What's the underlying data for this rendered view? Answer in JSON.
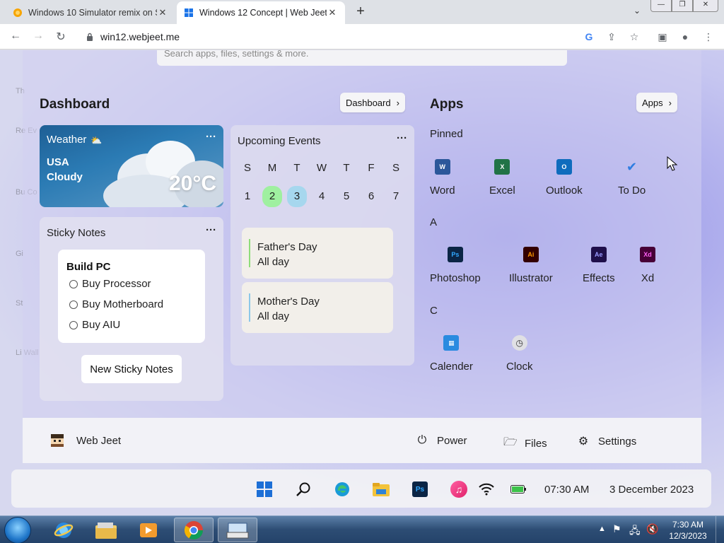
{
  "browser": {
    "tabs": [
      {
        "title": "Windows 10 Simulator remix on S",
        "active": false
      },
      {
        "title": "Windows 12 Concept | Web Jeet",
        "active": true
      }
    ],
    "url": "win12.webjeet.me"
  },
  "search": {
    "placeholder": "Search apps, files, settings & more."
  },
  "desktop_icons": [
    "Th",
    "Re Ev",
    "Bu Co",
    "Gi",
    "St",
    "Li Wall"
  ],
  "dashboard": {
    "title": "Dashboard",
    "button_label": "Dashboard",
    "weather": {
      "title": "Weather",
      "location": "USA",
      "condition": "Cloudy",
      "temperature": "20°C"
    },
    "sticky_notes": {
      "title": "Sticky Notes",
      "note_title": "Build PC",
      "items": [
        "Buy Processor",
        "Buy Motherboard",
        "Buy AIU"
      ],
      "new_button": "New Sticky Notes"
    },
    "events": {
      "title": "Upcoming Events",
      "weekdays": [
        "S",
        "M",
        "T",
        "W",
        "T",
        "F",
        "S"
      ],
      "days": [
        "1",
        "2",
        "3",
        "4",
        "5",
        "6",
        "7"
      ],
      "items": [
        {
          "name": "Father's Day",
          "time": "All day",
          "color": "#8fdc7a"
        },
        {
          "name": "Mother's Day",
          "time": "All day",
          "color": "#8cc7e8"
        }
      ]
    }
  },
  "apps": {
    "title": "Apps",
    "button_label": "Apps",
    "groups": [
      {
        "label": "Pinned",
        "apps": [
          "Word",
          "Excel",
          "Outlook",
          "To Do"
        ]
      },
      {
        "label": "A",
        "apps": [
          "Photoshop",
          "Illustrator",
          "Effects",
          "Xd"
        ]
      },
      {
        "label": "C",
        "apps": [
          "Calender",
          "Clock"
        ]
      }
    ],
    "icon_text": {
      "Photoshop": "Ps",
      "Illustrator": "Ai",
      "Effects": "Ae",
      "Xd": "Xd"
    }
  },
  "footer": {
    "user": "Web Jeet",
    "power": "Power",
    "files": "Files",
    "settings": "Settings"
  },
  "taskbar12": {
    "time": "07:30 AM",
    "date": "3 December 2023"
  },
  "taskbar7": {
    "time": "7:30 AM",
    "date": "12/3/2023"
  },
  "colors": {
    "accent": "#0078d4",
    "word": "#2b579a",
    "excel": "#217346",
    "outlook": "#0f6cbd",
    "photoshop": "#0b2545",
    "illustrator": "#330000",
    "effects": "#1f0f4a",
    "xd": "#470137"
  }
}
